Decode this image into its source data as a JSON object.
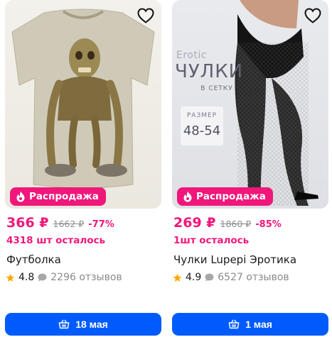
{
  "colors": {
    "accent": "#f0177b",
    "button": "#005bff",
    "star": "#ffa800"
  },
  "products": [
    {
      "badge": "Распродажа",
      "price": "366 ₽",
      "old_price": "1662 ₽",
      "discount": "-77%",
      "stock": "4318 шт осталось",
      "title": "Футболка",
      "rating": "4.8",
      "reviews": "2296 отзывов",
      "delivery": "18 мая"
    },
    {
      "image_text": {
        "brand": "Erotic",
        "headline": "ЧУЛКИ",
        "subline": "В СЕТКУ",
        "size_label": "РАЗМЕР",
        "size_value": "48-54"
      },
      "badge": "Распродажа",
      "price": "269 ₽",
      "old_price": "1860 ₽",
      "discount": "-85%",
      "stock": "1шт осталось",
      "title": "Чулки Lupepi Эротика",
      "rating": "4.9",
      "reviews": "6527 отзывов",
      "delivery": "1 мая"
    }
  ]
}
